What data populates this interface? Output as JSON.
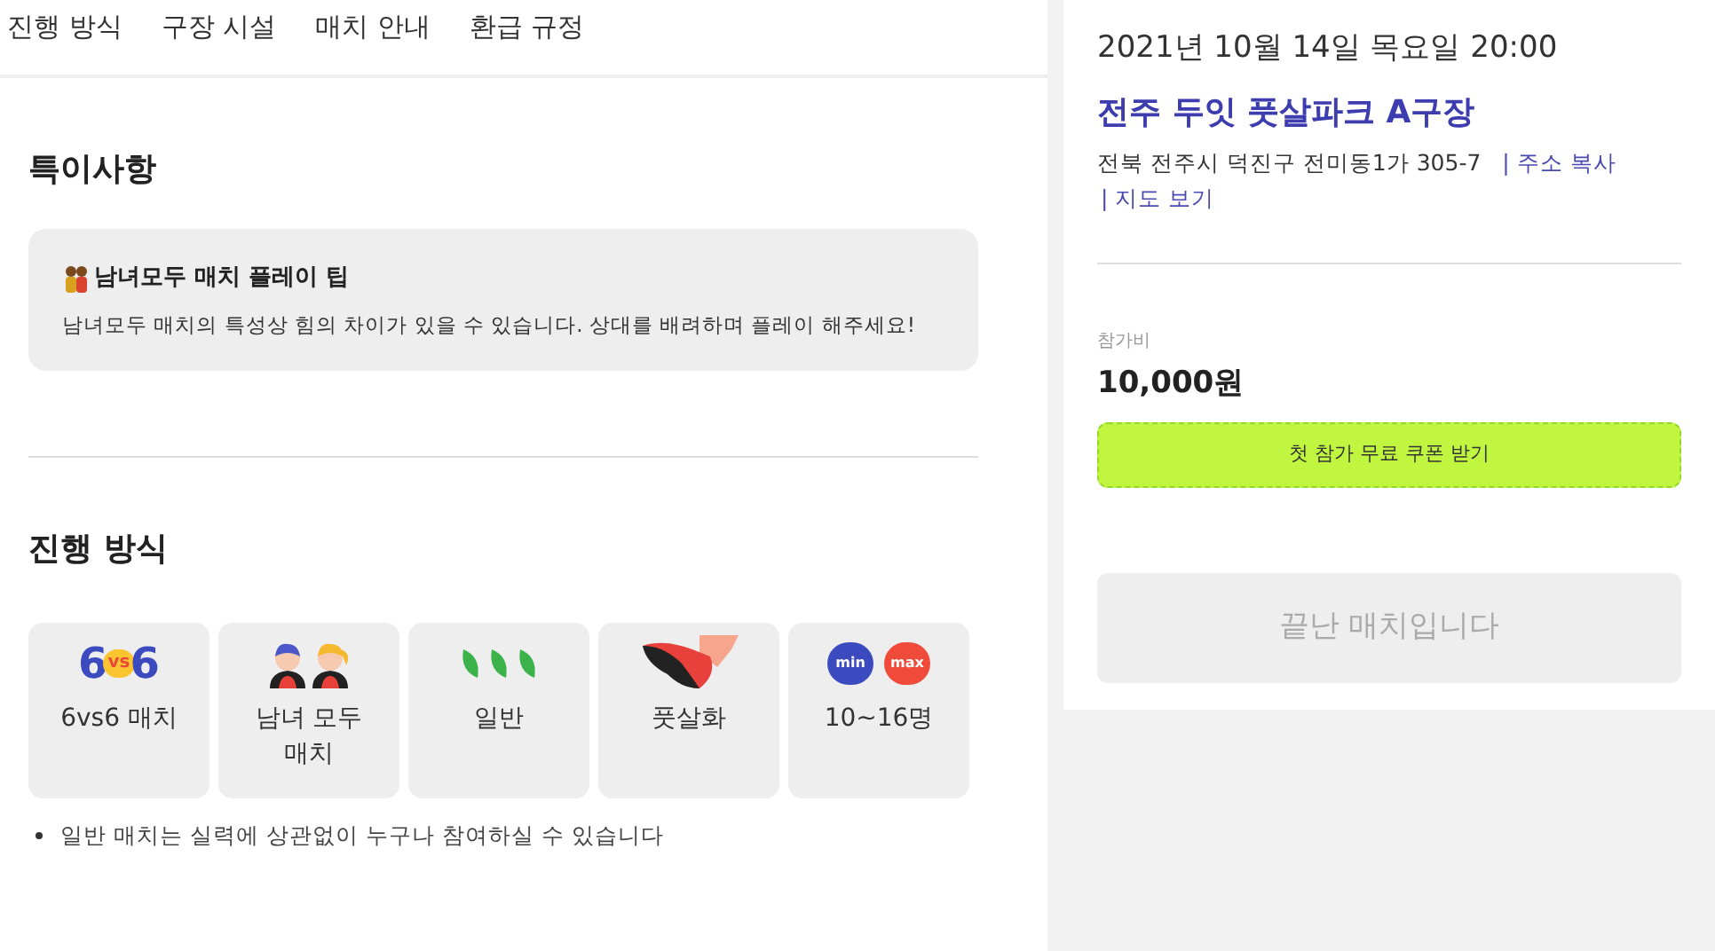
{
  "tabs": [
    {
      "label": "진행 방식"
    },
    {
      "label": "구장 시설"
    },
    {
      "label": "매치 안내"
    },
    {
      "label": "환급 규정"
    }
  ],
  "notes": {
    "title": "특이사항",
    "tip": {
      "title": "남녀모두 매치 플레이 팁",
      "body": "남녀모두 매치의 특성상 힘의 차이가 있을 수 있습니다. 상대를 배려하며 플레이 해주세요!"
    }
  },
  "rules": {
    "title": "진행 방식",
    "features": [
      {
        "kind": "versus",
        "icon_labels": [
          "6",
          "vs",
          "6"
        ],
        "label": "6vs6 매치"
      },
      {
        "kind": "mixed",
        "label": "남녀 모두 매치"
      },
      {
        "kind": "level",
        "label": "일반"
      },
      {
        "kind": "shoes",
        "label": "풋살화"
      },
      {
        "kind": "capacity",
        "icon_labels": [
          "min",
          "max"
        ],
        "label": "10~16명"
      }
    ],
    "bullets": [
      "일반 매치는 실력에 상관없이 누구나 참여하실 수 있습니다"
    ]
  },
  "match": {
    "datetime": "2021년 10월 14일 목요일 20:00",
    "venue": "전주 두잇 풋살파크 A구장",
    "address": "전북 전주시 덕진구 전미동1가 305-7",
    "links": [
      "| 주소 복사",
      "| 지도 보기"
    ],
    "fee_label": "참가비",
    "fee": "10,000원",
    "coupon_button": "첫 참가 무료 쿠폰 받기",
    "status_button": {
      "label": "끝난 매치입니다",
      "disabled": true
    }
  }
}
